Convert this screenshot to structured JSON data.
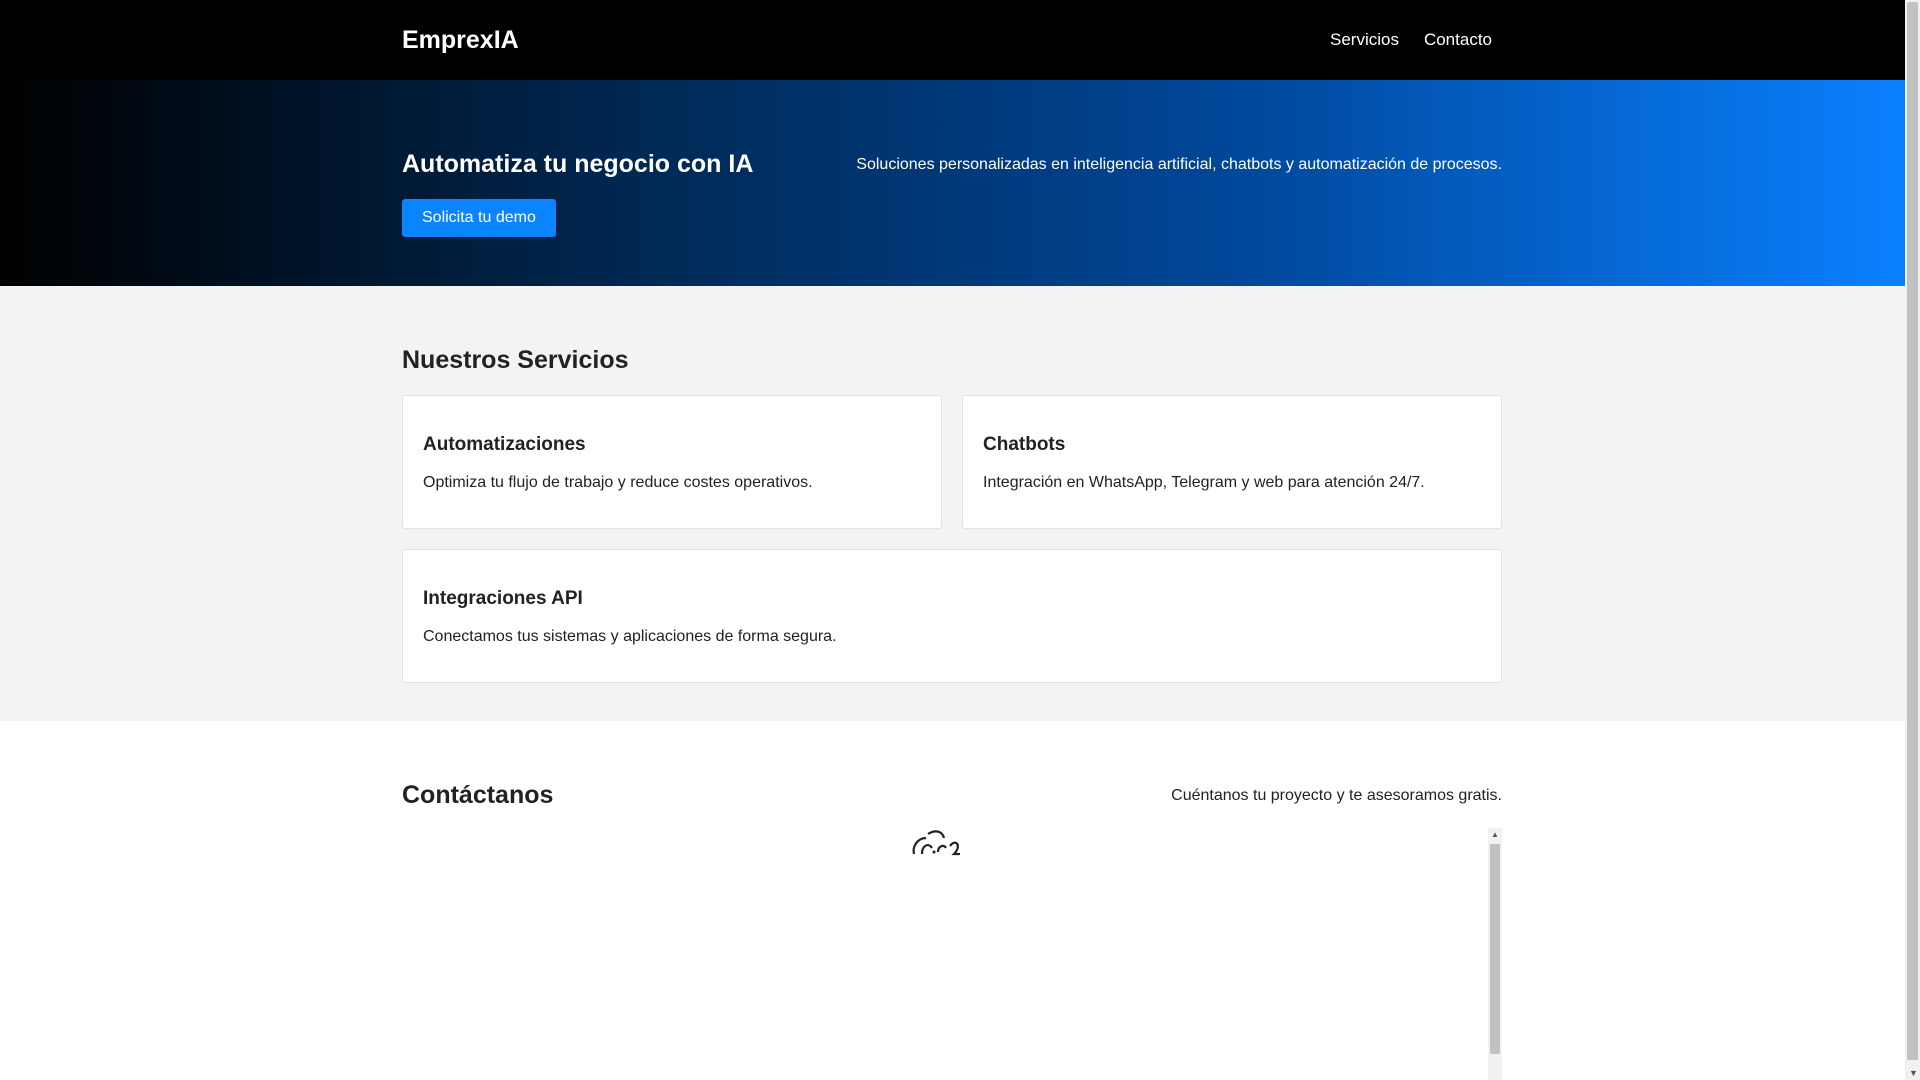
{
  "header": {
    "brand": "EmprexIA",
    "nav": [
      {
        "label": "Servicios"
      },
      {
        "label": "Contacto"
      }
    ]
  },
  "hero": {
    "title": "Automatiza tu negocio con IA",
    "subtitle": "Soluciones personalizadas en inteligencia artificial, chatbots y automatización de procesos.",
    "cta_label": "Solicita tu demo"
  },
  "services": {
    "title": "Nuestros Servicios",
    "items": [
      {
        "title": "Automatizaciones",
        "text": "Optimiza tu flujo de trabajo y reduce costes operativos."
      },
      {
        "title": "Chatbots",
        "text": "Integración en WhatsApp, Telegram y web para atención 24/7."
      },
      {
        "title": "Integraciones API",
        "text": "Conectamos tus sistemas y aplicaciones de forma segura."
      }
    ]
  },
  "contact": {
    "title": "Contáctanos",
    "subtitle": "Cuéntanos tu proyecto y te asesoramos gratis."
  },
  "colors": {
    "header_bg": "#000000",
    "accent": "#0a84ff",
    "section_bg": "#f3f3f3"
  }
}
